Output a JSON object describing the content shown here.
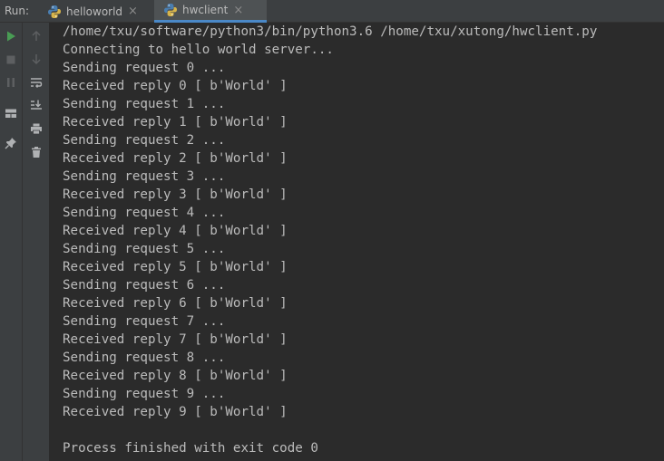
{
  "run_label": "Run:",
  "tabs": [
    {
      "label": "helloworld",
      "close": "×",
      "active": false
    },
    {
      "label": "hwclient",
      "close": "×",
      "active": true
    }
  ],
  "left_toolbar": [
    "run-icon",
    "stop-icon",
    "pause-icon",
    "layout-icon",
    "pin-icon"
  ],
  "second_toolbar": [
    "up-arrow-icon",
    "down-arrow-icon",
    "soft-wrap-icon",
    "scroll-to-end-icon",
    "print-icon",
    "trash-icon"
  ],
  "colors": {
    "run_green": "#499c54",
    "tab_underline": "#4a88c7",
    "console_bg": "#2b2b2b",
    "text": "#bbbbbb"
  },
  "console": {
    "lines": [
      "/home/txu/software/python3/bin/python3.6 /home/txu/xutong/hwclient.py",
      "Connecting to hello world server...",
      "Sending request 0 ...",
      "Received reply 0 [ b'World' ]",
      "Sending request 1 ...",
      "Received reply 1 [ b'World' ]",
      "Sending request 2 ...",
      "Received reply 2 [ b'World' ]",
      "Sending request 3 ...",
      "Received reply 3 [ b'World' ]",
      "Sending request 4 ...",
      "Received reply 4 [ b'World' ]",
      "Sending request 5 ...",
      "Received reply 5 [ b'World' ]",
      "Sending request 6 ...",
      "Received reply 6 [ b'World' ]",
      "Sending request 7 ...",
      "Received reply 7 [ b'World' ]",
      "Sending request 8 ...",
      "Received reply 8 [ b'World' ]",
      "Sending request 9 ...",
      "Received reply 9 [ b'World' ]",
      "",
      "Process finished with exit code 0"
    ]
  }
}
